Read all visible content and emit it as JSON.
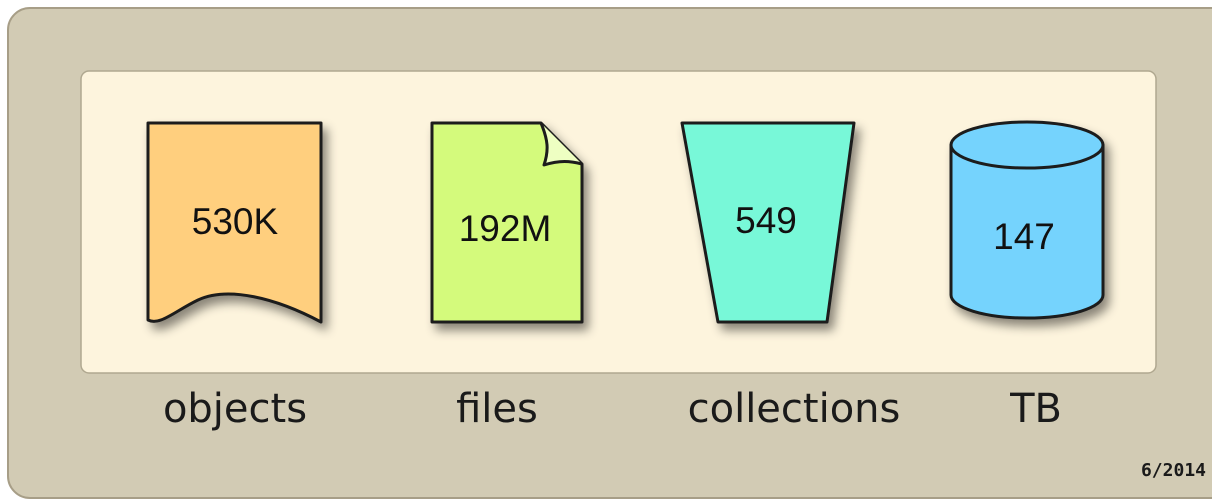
{
  "stats": [
    {
      "value": "530K",
      "label": "objects",
      "color": "#FFCF7E",
      "icon": "wavy-document-icon"
    },
    {
      "value": "192M",
      "label": "files",
      "color": "#D4FA7C",
      "icon": "folded-file-icon"
    },
    {
      "value": "549",
      "label": "collections",
      "color": "#78F8D8",
      "icon": "bucket-icon"
    },
    {
      "value": "147",
      "label": "TB",
      "color": "#74D3FD",
      "icon": "database-cylinder-icon"
    }
  ],
  "date": "6/2014",
  "colors": {
    "frame": "#D2CBB4",
    "inner_panel": "#FDF4DD"
  }
}
